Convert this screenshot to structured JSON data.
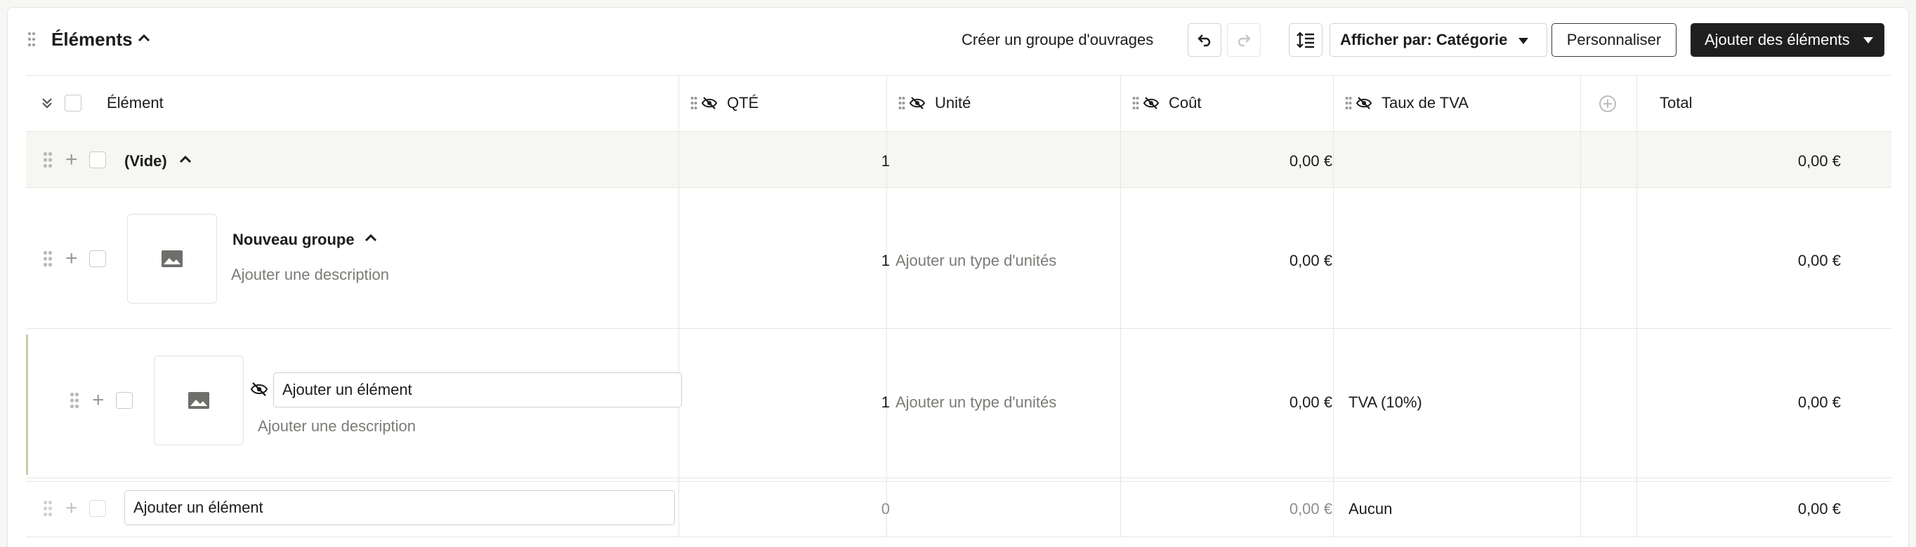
{
  "header": {
    "title": "Éléments",
    "create_group_label": "Créer un groupe d'ouvrages",
    "view_by_label": "Afficher par: Catégorie",
    "customize_label": "Personnaliser",
    "add_elements_label": "Ajouter des éléments"
  },
  "columns": {
    "element": "Élément",
    "qty": "QTÉ",
    "unit": "Unité",
    "cost": "Coût",
    "vat": "Taux de TVA",
    "total": "Total"
  },
  "rows": {
    "empty_group": {
      "label": "(Vide)",
      "qty": "1",
      "cost": "0,00 €",
      "total": "0,00 €"
    },
    "new_group": {
      "title": "Nouveau groupe",
      "description_placeholder": "Ajouter une description",
      "qty": "1",
      "unit_placeholder": "Ajouter un type d'unités",
      "cost": "0,00 €",
      "total": "0,00 €"
    },
    "hidden_item": {
      "name_placeholder": "Ajouter un élément",
      "description_placeholder": "Ajouter une description",
      "qty": "1",
      "unit_placeholder": "Ajouter un type d'unités",
      "cost": "0,00 €",
      "vat": "TVA (10%)",
      "total": "0,00 €"
    },
    "new_item": {
      "name_placeholder": "Ajouter un élément",
      "qty": "0",
      "cost": "0,00 €",
      "vat": "Aucun",
      "total": "0,00 €"
    }
  },
  "icons": {
    "grip": "drag-handle-icon",
    "chevron": "chevron-up-icon",
    "undo": "undo-icon",
    "redo": "redo-icon",
    "sort": "line-height-icon",
    "hidden": "eye-off-icon",
    "image": "image-placeholder-icon",
    "add_column": "plus-circle-icon",
    "collapse_all": "chevrons-collapse-icon"
  },
  "colors": {
    "primary_button": "#1f1f1f",
    "group_row_bg": "#f6f6f3",
    "nested_accent": "#cfc9a6",
    "muted_text": "#7b7b77"
  }
}
